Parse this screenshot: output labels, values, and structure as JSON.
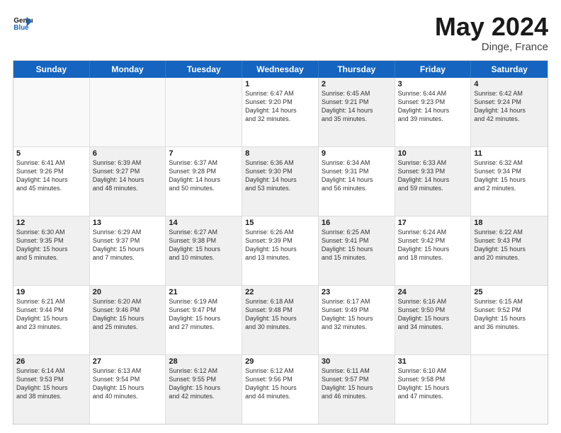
{
  "header": {
    "logo_general": "General",
    "logo_blue": "Blue",
    "main_title": "May 2024",
    "subtitle": "Dinge, France"
  },
  "weekdays": [
    "Sunday",
    "Monday",
    "Tuesday",
    "Wednesday",
    "Thursday",
    "Friday",
    "Saturday"
  ],
  "rows": [
    [
      {
        "day": "",
        "lines": [],
        "shade": "empty"
      },
      {
        "day": "",
        "lines": [],
        "shade": "empty"
      },
      {
        "day": "",
        "lines": [],
        "shade": "empty"
      },
      {
        "day": "1",
        "lines": [
          "Sunrise: 6:47 AM",
          "Sunset: 9:20 PM",
          "Daylight: 14 hours",
          "and 32 minutes."
        ],
        "shade": ""
      },
      {
        "day": "2",
        "lines": [
          "Sunrise: 6:45 AM",
          "Sunset: 9:21 PM",
          "Daylight: 14 hours",
          "and 35 minutes."
        ],
        "shade": "shaded"
      },
      {
        "day": "3",
        "lines": [
          "Sunrise: 6:44 AM",
          "Sunset: 9:23 PM",
          "Daylight: 14 hours",
          "and 39 minutes."
        ],
        "shade": ""
      },
      {
        "day": "4",
        "lines": [
          "Sunrise: 6:42 AM",
          "Sunset: 9:24 PM",
          "Daylight: 14 hours",
          "and 42 minutes."
        ],
        "shade": "shaded"
      }
    ],
    [
      {
        "day": "5",
        "lines": [
          "Sunrise: 6:41 AM",
          "Sunset: 9:26 PM",
          "Daylight: 14 hours",
          "and 45 minutes."
        ],
        "shade": ""
      },
      {
        "day": "6",
        "lines": [
          "Sunrise: 6:39 AM",
          "Sunset: 9:27 PM",
          "Daylight: 14 hours",
          "and 48 minutes."
        ],
        "shade": "shaded"
      },
      {
        "day": "7",
        "lines": [
          "Sunrise: 6:37 AM",
          "Sunset: 9:28 PM",
          "Daylight: 14 hours",
          "and 50 minutes."
        ],
        "shade": ""
      },
      {
        "day": "8",
        "lines": [
          "Sunrise: 6:36 AM",
          "Sunset: 9:30 PM",
          "Daylight: 14 hours",
          "and 53 minutes."
        ],
        "shade": "shaded"
      },
      {
        "day": "9",
        "lines": [
          "Sunrise: 6:34 AM",
          "Sunset: 9:31 PM",
          "Daylight: 14 hours",
          "and 56 minutes."
        ],
        "shade": ""
      },
      {
        "day": "10",
        "lines": [
          "Sunrise: 6:33 AM",
          "Sunset: 9:33 PM",
          "Daylight: 14 hours",
          "and 59 minutes."
        ],
        "shade": "shaded"
      },
      {
        "day": "11",
        "lines": [
          "Sunrise: 6:32 AM",
          "Sunset: 9:34 PM",
          "Daylight: 15 hours",
          "and 2 minutes."
        ],
        "shade": ""
      }
    ],
    [
      {
        "day": "12",
        "lines": [
          "Sunrise: 6:30 AM",
          "Sunset: 9:35 PM",
          "Daylight: 15 hours",
          "and 5 minutes."
        ],
        "shade": "shaded"
      },
      {
        "day": "13",
        "lines": [
          "Sunrise: 6:29 AM",
          "Sunset: 9:37 PM",
          "Daylight: 15 hours",
          "and 7 minutes."
        ],
        "shade": ""
      },
      {
        "day": "14",
        "lines": [
          "Sunrise: 6:27 AM",
          "Sunset: 9:38 PM",
          "Daylight: 15 hours",
          "and 10 minutes."
        ],
        "shade": "shaded"
      },
      {
        "day": "15",
        "lines": [
          "Sunrise: 6:26 AM",
          "Sunset: 9:39 PM",
          "Daylight: 15 hours",
          "and 13 minutes."
        ],
        "shade": ""
      },
      {
        "day": "16",
        "lines": [
          "Sunrise: 6:25 AM",
          "Sunset: 9:41 PM",
          "Daylight: 15 hours",
          "and 15 minutes."
        ],
        "shade": "shaded"
      },
      {
        "day": "17",
        "lines": [
          "Sunrise: 6:24 AM",
          "Sunset: 9:42 PM",
          "Daylight: 15 hours",
          "and 18 minutes."
        ],
        "shade": ""
      },
      {
        "day": "18",
        "lines": [
          "Sunrise: 6:22 AM",
          "Sunset: 9:43 PM",
          "Daylight: 15 hours",
          "and 20 minutes."
        ],
        "shade": "shaded"
      }
    ],
    [
      {
        "day": "19",
        "lines": [
          "Sunrise: 6:21 AM",
          "Sunset: 9:44 PM",
          "Daylight: 15 hours",
          "and 23 minutes."
        ],
        "shade": ""
      },
      {
        "day": "20",
        "lines": [
          "Sunrise: 6:20 AM",
          "Sunset: 9:46 PM",
          "Daylight: 15 hours",
          "and 25 minutes."
        ],
        "shade": "shaded"
      },
      {
        "day": "21",
        "lines": [
          "Sunrise: 6:19 AM",
          "Sunset: 9:47 PM",
          "Daylight: 15 hours",
          "and 27 minutes."
        ],
        "shade": ""
      },
      {
        "day": "22",
        "lines": [
          "Sunrise: 6:18 AM",
          "Sunset: 9:48 PM",
          "Daylight: 15 hours",
          "and 30 minutes."
        ],
        "shade": "shaded"
      },
      {
        "day": "23",
        "lines": [
          "Sunrise: 6:17 AM",
          "Sunset: 9:49 PM",
          "Daylight: 15 hours",
          "and 32 minutes."
        ],
        "shade": ""
      },
      {
        "day": "24",
        "lines": [
          "Sunrise: 6:16 AM",
          "Sunset: 9:50 PM",
          "Daylight: 15 hours",
          "and 34 minutes."
        ],
        "shade": "shaded"
      },
      {
        "day": "25",
        "lines": [
          "Sunrise: 6:15 AM",
          "Sunset: 9:52 PM",
          "Daylight: 15 hours",
          "and 36 minutes."
        ],
        "shade": ""
      }
    ],
    [
      {
        "day": "26",
        "lines": [
          "Sunrise: 6:14 AM",
          "Sunset: 9:53 PM",
          "Daylight: 15 hours",
          "and 38 minutes."
        ],
        "shade": "shaded"
      },
      {
        "day": "27",
        "lines": [
          "Sunrise: 6:13 AM",
          "Sunset: 9:54 PM",
          "Daylight: 15 hours",
          "and 40 minutes."
        ],
        "shade": ""
      },
      {
        "day": "28",
        "lines": [
          "Sunrise: 6:12 AM",
          "Sunset: 9:55 PM",
          "Daylight: 15 hours",
          "and 42 minutes."
        ],
        "shade": "shaded"
      },
      {
        "day": "29",
        "lines": [
          "Sunrise: 6:12 AM",
          "Sunset: 9:56 PM",
          "Daylight: 15 hours",
          "and 44 minutes."
        ],
        "shade": ""
      },
      {
        "day": "30",
        "lines": [
          "Sunrise: 6:11 AM",
          "Sunset: 9:57 PM",
          "Daylight: 15 hours",
          "and 46 minutes."
        ],
        "shade": "shaded"
      },
      {
        "day": "31",
        "lines": [
          "Sunrise: 6:10 AM",
          "Sunset: 9:58 PM",
          "Daylight: 15 hours",
          "and 47 minutes."
        ],
        "shade": ""
      },
      {
        "day": "",
        "lines": [],
        "shade": "empty"
      }
    ]
  ]
}
